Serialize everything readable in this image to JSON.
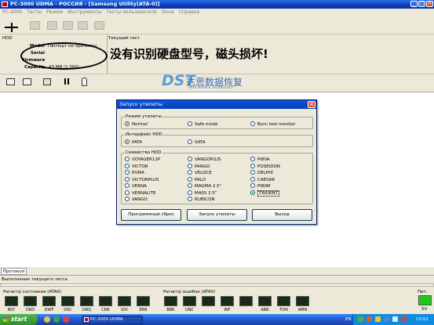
{
  "window": {
    "title": "PC-3000 UDMA - РОССИЯ - [Samsung Utility(ATA-0)]",
    "buttons": [
      "_",
      "□",
      "×"
    ]
  },
  "menu": [
    "PC-3000",
    "Тесты",
    "Режим",
    "Инструменты",
    "Тесты пользователя",
    "Окна",
    "Справка"
  ],
  "hdd_panel": {
    "header": "HDD",
    "current_test_label": "Текущий тест",
    "fields": [
      {
        "label": "Model",
        "value": "Паспорт не прочитан"
      },
      {
        "label": "Serial",
        "value": ""
      },
      {
        "label": "Firmware",
        "value": ""
      },
      {
        "label": "Capacity",
        "value": "43 MB (1 000)"
      }
    ]
  },
  "annotation_text": "没有识别硬盘型号，磁头损坏!",
  "watermark": {
    "brand": "DST",
    "name": "达思数据恢复",
    "sub": "DATA SERVICE TECHNOLOGY"
  },
  "dialog": {
    "title": "Запуск утилиты",
    "close": "×",
    "mode_group": {
      "title": "Режим утилиты",
      "options": [
        {
          "label": "Normal",
          "checked": true
        },
        {
          "label": "Safe mode",
          "checked": false
        },
        {
          "label": "Burn test monitor",
          "checked": false
        }
      ]
    },
    "interface_group": {
      "title": "Интерфейс HDD",
      "options": [
        {
          "label": "PATA",
          "checked": true
        },
        {
          "label": "SATA",
          "checked": false
        }
      ]
    },
    "family_group": {
      "title": "Семейства HDD",
      "col1": [
        "VOYAGER11P",
        "VICTOR",
        "PUMA",
        "VICTORPLUS",
        "VERNA",
        "VERNALITE",
        "VANGO"
      ],
      "col2": [
        "VANGOPLUS",
        "PANGO",
        "VELOCE",
        "PALO",
        "MAGMA 2.5\"",
        "M40S 2.5\"",
        "RUBICON"
      ],
      "col3": [
        "PI80A",
        "POSEIDON",
        "DELPHI",
        "CAESAR",
        "PI80M",
        "TRIDENT"
      ],
      "selected": "TRIDENT"
    },
    "buttons": {
      "reset": "Программный сброс",
      "start": "Запуск утилиты",
      "exit": "Выход"
    }
  },
  "protocol_tab": "Протокол",
  "progress_label": "Выполнение текущего теста",
  "status_register": {
    "title": "Регистр состояния (ATA0)",
    "bits": [
      "BSY",
      "DRD",
      "DWF",
      "DSC",
      "DRQ",
      "CRR",
      "IDX",
      "ERR"
    ]
  },
  "error_register": {
    "title": "Регистр ошибок (ATA0)",
    "bits": [
      "BBK",
      "UNC",
      "",
      "INF",
      "",
      "ABR",
      "TON",
      "AMN"
    ]
  },
  "power": {
    "title": "Пит.",
    "label": "5V"
  },
  "taskbar": {
    "start": "start",
    "task": "PC-3000 UDMA",
    "lang": "EN",
    "clock": "10:51"
  }
}
